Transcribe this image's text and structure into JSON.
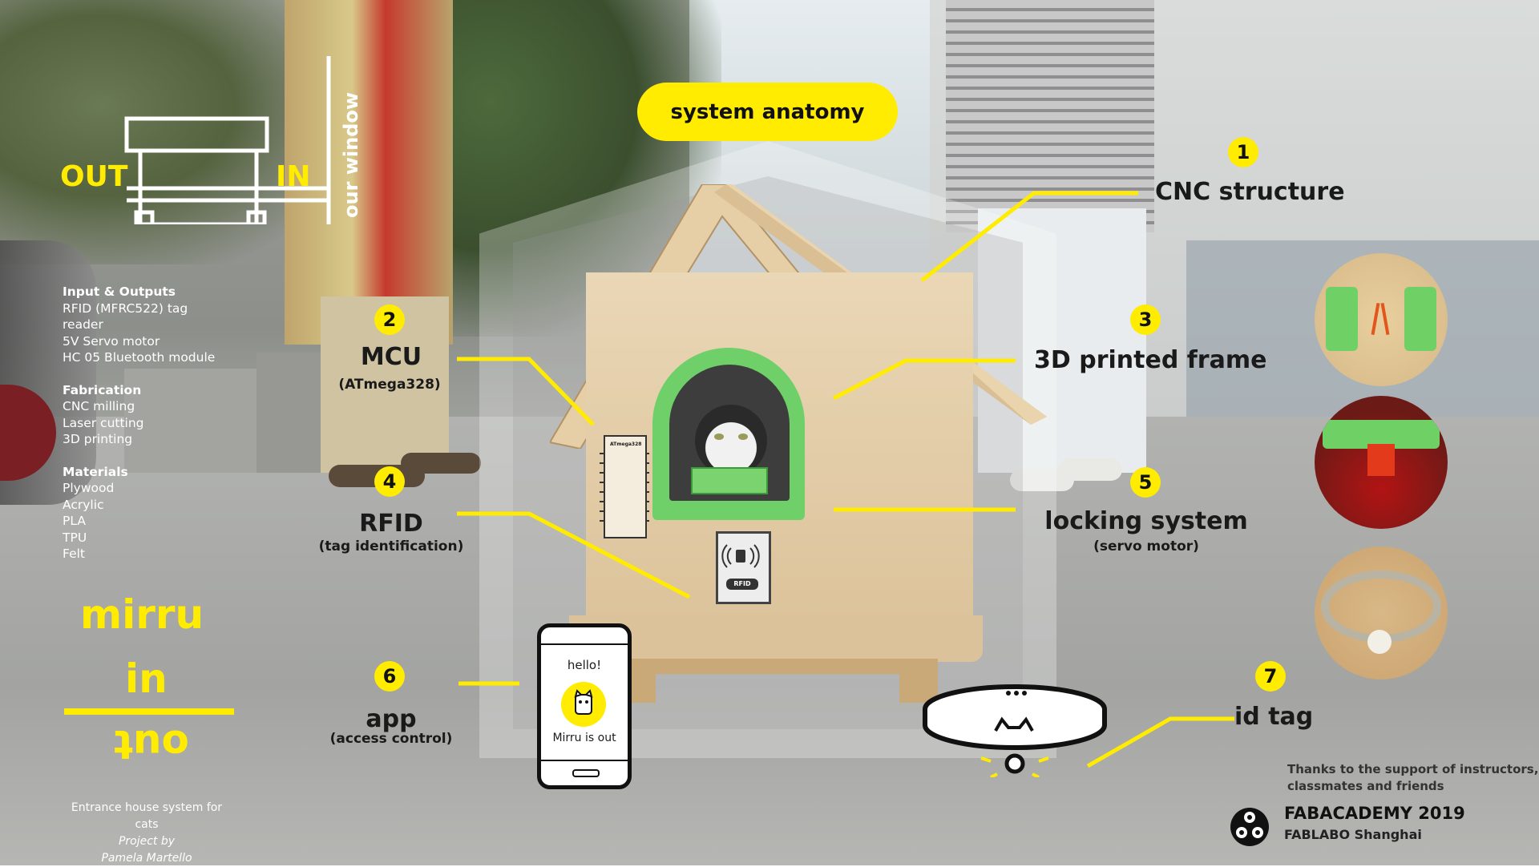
{
  "title": "system anatomy",
  "window_diagram": {
    "out": "OUT",
    "in": "IN",
    "side_label": "our window"
  },
  "specs": {
    "inputs_heading": "Input & Outputs",
    "inputs": [
      "RFID (MFRC522) tag reader",
      "5V Servo motor",
      "HC 05 Bluetooth module"
    ],
    "fabrication_heading": "Fabrication",
    "fabrication": [
      "CNC milling",
      "Laser cutting",
      "3D printing"
    ],
    "materials_heading": "Materials",
    "materials": [
      "Plywood",
      "Acrylic",
      "PLA",
      "TPU",
      "Felt"
    ]
  },
  "brand": {
    "line1": "mirru",
    "line2": "in",
    "line3": "out"
  },
  "credit": {
    "line1": "Entrance house system for cats",
    "line2": "Project by",
    "line3": "Pamela Martello"
  },
  "components": [
    {
      "num": "1",
      "label": "CNC structure",
      "sub": ""
    },
    {
      "num": "2",
      "label": "MCU",
      "sub": "(ATmega328)"
    },
    {
      "num": "3",
      "label": "3D printed frame",
      "sub": ""
    },
    {
      "num": "4",
      "label": "RFID",
      "sub": "(tag identification)"
    },
    {
      "num": "5",
      "label": "locking system",
      "sub": "(servo motor)"
    },
    {
      "num": "6",
      "label": "app",
      "sub": "(access control)"
    },
    {
      "num": "7",
      "label": "id tag",
      "sub": ""
    }
  ],
  "house": {
    "chip_label": "ATmega328",
    "rfid_label": "RFID"
  },
  "phone": {
    "greeting": "hello!",
    "status": "Mirru is out"
  },
  "footer": {
    "thanks_line1": "Thanks to the support of instructors,",
    "thanks_line2": "classmates and friends",
    "fab_title": "FABACADEMY 2019",
    "fab_lab": "FABLABO Shanghai"
  },
  "colors": {
    "accent": "#ffec00",
    "frame_green": "#6fd06a",
    "plywood": "#e2cba4"
  },
  "icons": [
    "window-diagram-icon",
    "smartphone-icon",
    "cat-avatar-icon",
    "collar-icon",
    "fabacademy-logo-icon"
  ]
}
